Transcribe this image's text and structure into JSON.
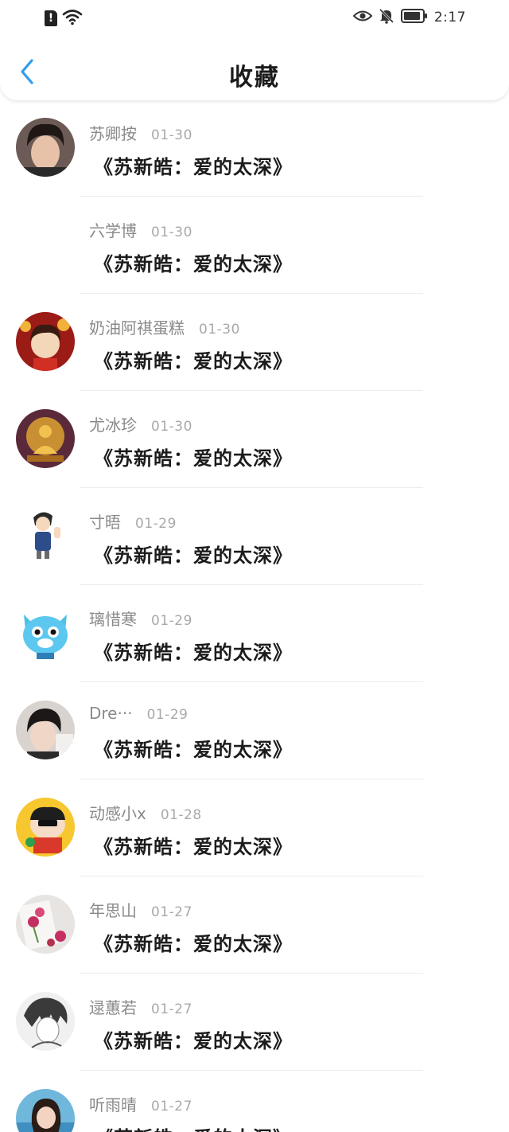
{
  "status_bar": {
    "time": "2:17",
    "left_icons": [
      "sim-alert-icon",
      "wifi-icon"
    ],
    "right_icons": [
      "eye-icon",
      "bell-muted-icon",
      "battery-icon"
    ]
  },
  "header": {
    "title": "收藏",
    "back_icon": "chevron-left-icon",
    "accent_color": "#2f9cf0"
  },
  "items": [
    {
      "username": "苏卿按",
      "date": "01-30",
      "title": "《苏新皓：爱的太深》",
      "avatar": "avatar-photo-boy"
    },
    {
      "username": "六学博",
      "date": "01-30",
      "title": "《苏新皓：爱的太深》",
      "avatar": "none"
    },
    {
      "username": "奶油阿祺蛋糕",
      "date": "01-30",
      "title": "《苏新皓：爱的太深》",
      "avatar": "avatar-lion-dance-girl"
    },
    {
      "username": "尤冰珍",
      "date": "01-30",
      "title": "《苏新皓：爱的太深》",
      "avatar": "avatar-buddha-statue"
    },
    {
      "username": "寸晤",
      "date": "01-29",
      "title": "《苏新皓：爱的太深》",
      "avatar": "avatar-cartoon-detective"
    },
    {
      "username": "璃惜寒",
      "date": "01-29",
      "title": "《苏新皓：爱的太深》",
      "avatar": "avatar-blue-cat"
    },
    {
      "username": "Dre···",
      "date": "01-29",
      "title": "《苏新皓：爱的太深》",
      "avatar": "avatar-photo-boy-2"
    },
    {
      "username": "动感小x",
      "date": "01-28",
      "title": "《苏新皓：爱的太深》",
      "avatar": "avatar-cartoon-kid"
    },
    {
      "username": "年思山",
      "date": "01-27",
      "title": "《苏新皓：爱的太深》",
      "avatar": "avatar-flowers"
    },
    {
      "username": "逯蕙若",
      "date": "01-27",
      "title": "《苏新皓：爱的太深》",
      "avatar": "avatar-anime-sketch"
    },
    {
      "username": "听雨晴",
      "date": "01-27",
      "title": "《苏新皓：爱的太深》",
      "avatar": "avatar-photo-girl"
    }
  ]
}
